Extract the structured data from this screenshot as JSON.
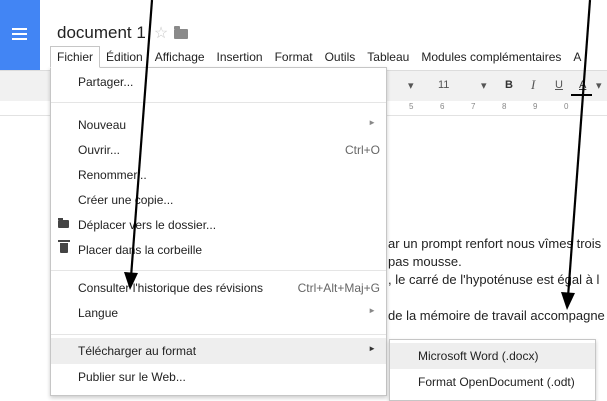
{
  "header": {
    "title": "document 1",
    "star_icon": "star-outline-icon",
    "folder_icon": "folder-icon"
  },
  "menubar": {
    "items": [
      "Fichier",
      "Édition",
      "Affichage",
      "Insertion",
      "Format",
      "Outils",
      "Tableau",
      "Modules complémentaires",
      "A"
    ]
  },
  "toolbar": {
    "font_size": "11",
    "bold": "B",
    "italic": "I",
    "underline": "U",
    "text_color": "A"
  },
  "ruler": [
    "5",
    "6",
    "7",
    "8",
    "9",
    "0"
  ],
  "document": {
    "lines": [
      "ar un prompt renfort nous vîmes trois",
      "pas mousse.",
      ", le carré de l'hypoténuse est égal à l",
      "de la mémoire de travail accompagne"
    ]
  },
  "file_menu": {
    "items": [
      {
        "label": "Partager..."
      },
      {
        "label": "Nouveau",
        "submenu": true
      },
      {
        "label": "Ouvrir...",
        "shortcut": "Ctrl+O"
      },
      {
        "label": "Renommer..."
      },
      {
        "label": "Créer une copie..."
      },
      {
        "label": "Déplacer vers le dossier...",
        "icon": "folder-icon"
      },
      {
        "label": "Placer dans la corbeille",
        "icon": "trash-icon"
      },
      {
        "label": "Consulter l'historique des révisions",
        "shortcut": "Ctrl+Alt+Maj+G"
      },
      {
        "label": "Langue",
        "submenu": true
      },
      {
        "label": "Télécharger au format",
        "submenu": true,
        "highlighted": true
      },
      {
        "label": "Publier sur le Web..."
      }
    ]
  },
  "submenu": {
    "items": [
      "Microsoft Word (.docx)",
      "Format OpenDocument (.odt)"
    ]
  },
  "colors": {
    "docs_blue": "#4285f4",
    "menu_highlight": "#eeeeee",
    "annotation_arrow": "#000000"
  }
}
